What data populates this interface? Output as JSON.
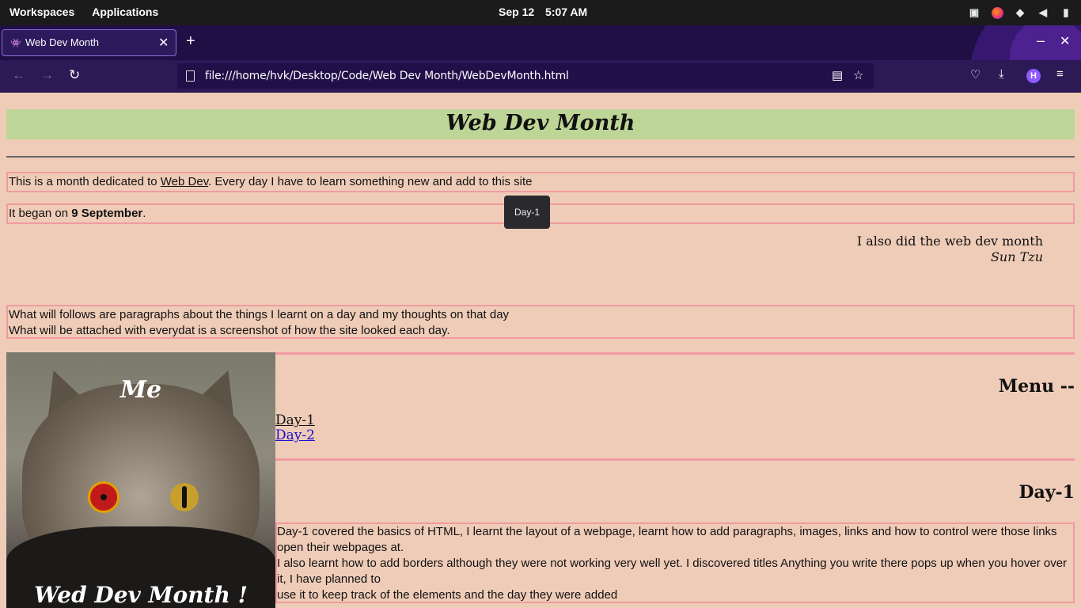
{
  "system_bar": {
    "workspaces": "Workspaces",
    "applications": "Applications",
    "date": "Sep 12",
    "time": "5:07 AM"
  },
  "browser": {
    "tab_title": "Web Dev Month",
    "url": "file:///home/hvk/Desktop/Code/Web Dev Month/WebDevMonth.html",
    "account_initial": "H"
  },
  "page": {
    "title": "Web Dev Month",
    "intro": {
      "before_link": "This is a month dedicated to ",
      "link_text": "Web Dev",
      "after_link": ". Every day I have to learn something new and add to this site"
    },
    "began": {
      "prefix": "It began on ",
      "date": "9 September",
      "suffix": "."
    },
    "tooltip": "Day-1",
    "quote": {
      "text": "I also did the web dev month",
      "author": "Sun Tzu"
    },
    "follow_text": {
      "line1": "What will follows are paragraphs about the things I learnt on a day and my thoughts on that day",
      "line2": "What will be attached with everydat is a screenshot of how the site looked each day."
    },
    "image_caption_top": "Me",
    "image_caption_bottom": "Wed Dev Month !",
    "menu_heading": "Menu --",
    "menu_links": [
      "Day-1",
      "Day-2"
    ],
    "day1": {
      "heading": "Day-1",
      "lines": [
        "Day-1 covered the basics of HTML, I learnt the layout of a webpage, learnt how to add paragraphs, images, links and how to control were those links open their webpages at.",
        "I also learnt how to add borders although they were not working very well yet. I discovered titles Anything you write there pops up when you hover over it, I have planned to",
        "use it to keep track of the elements and the day they were added"
      ]
    }
  },
  "colors": {
    "page_background": "#efccb8",
    "title_background": "#bdd697",
    "border_pink": "#f09aa0",
    "browser_chrome": "#2b1a55"
  }
}
